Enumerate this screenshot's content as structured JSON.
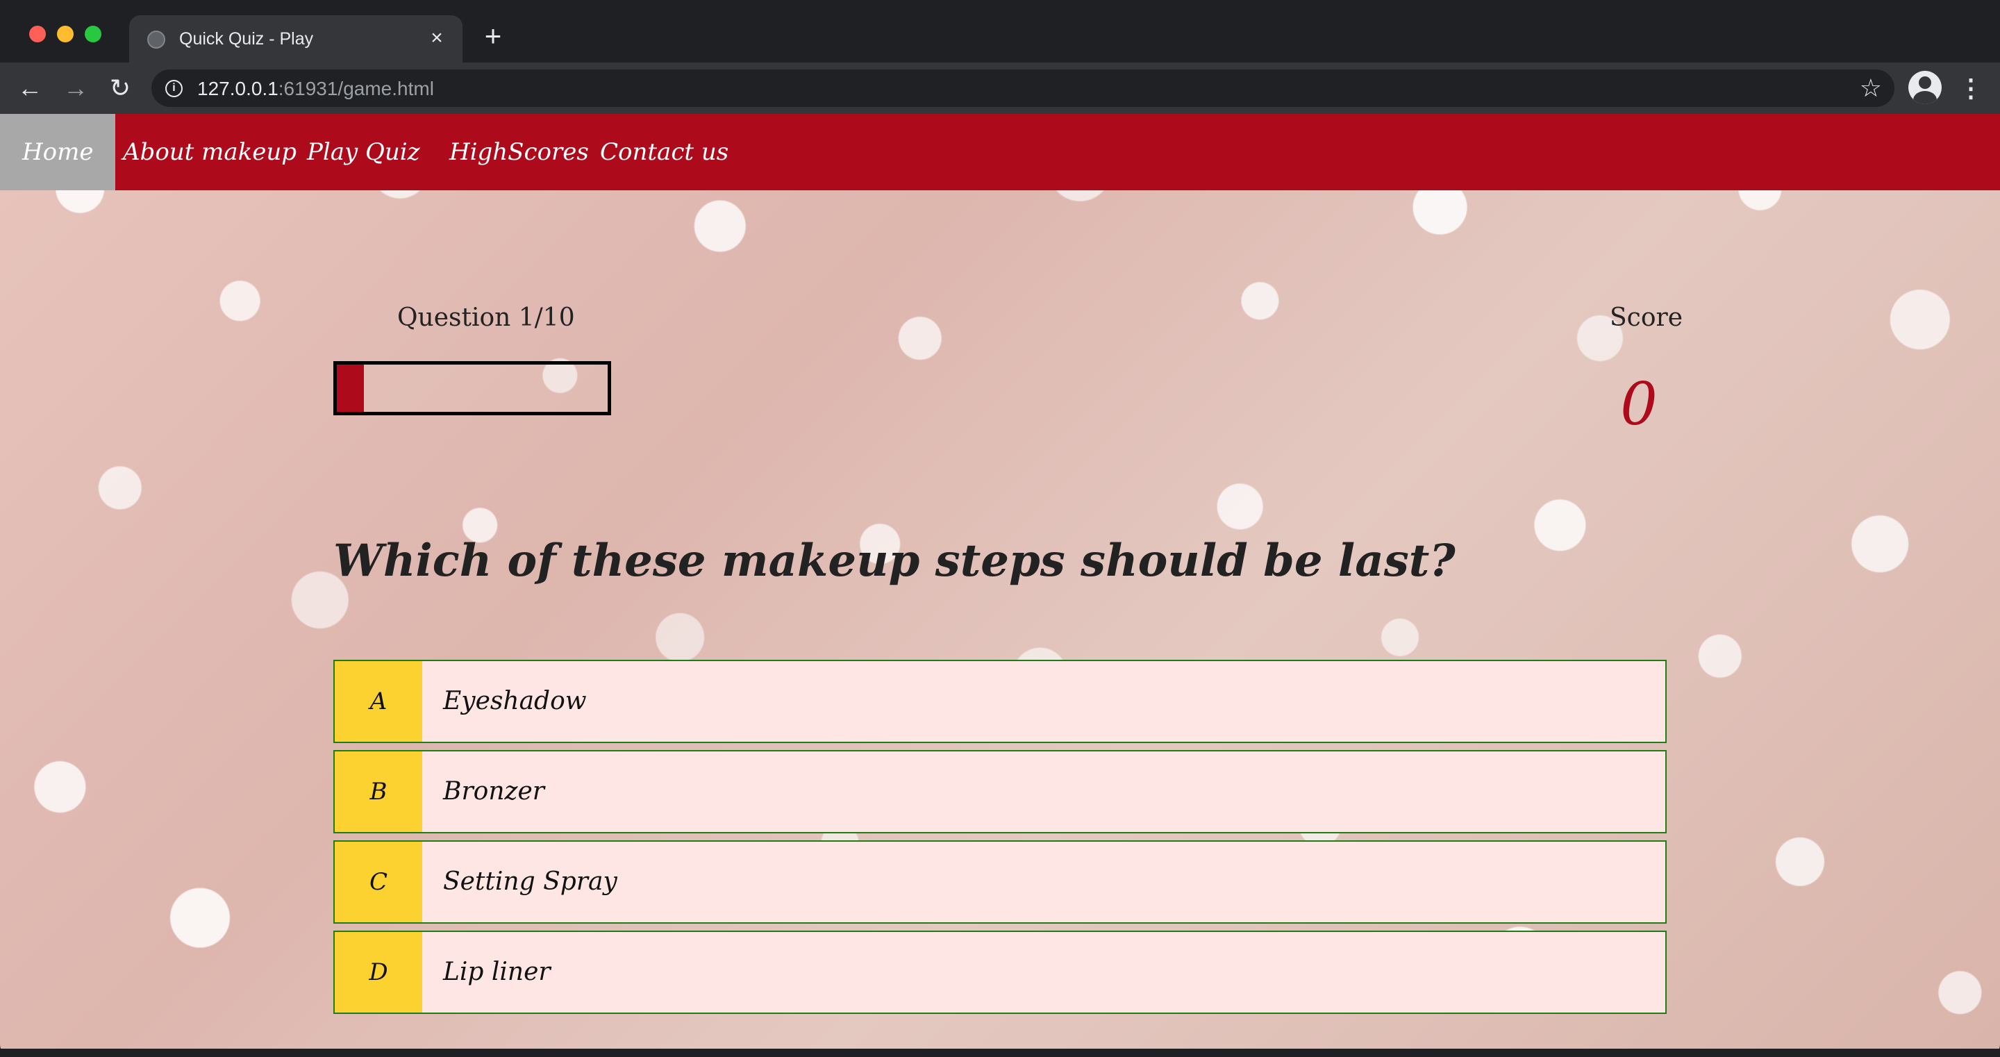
{
  "browser": {
    "tab_title": "Quick Quiz - Play",
    "tab_close": "×",
    "new_tab": "+",
    "url_host": "127.0.0.1",
    "url_rest": ":61931/game.html",
    "icons": {
      "back": "arrow-left-icon",
      "forward": "arrow-right-icon",
      "reload": "reload-icon",
      "info": "info-icon",
      "star": "star-icon",
      "profile": "profile-icon",
      "menu": "kebab-menu-icon"
    }
  },
  "navbar": {
    "items": [
      {
        "label": "Home",
        "active": true
      },
      {
        "label": "About makeup",
        "active": false
      },
      {
        "label": "Play Quiz",
        "active": false
      },
      {
        "label": "HighScores",
        "active": false
      },
      {
        "label": "Contact us",
        "active": false
      }
    ]
  },
  "hud": {
    "question_counter": "Question 1/10",
    "progress_fraction": 0.1,
    "score_label": "Score",
    "score_value": "0"
  },
  "question": {
    "text": "Which of these makeup steps should be last?"
  },
  "choices": [
    {
      "prefix": "A",
      "text": "Eyeshadow"
    },
    {
      "prefix": "B",
      "text": "Bronzer"
    },
    {
      "prefix": "C",
      "text": "Setting Spray"
    },
    {
      "prefix": "D",
      "text": "Lip liner"
    }
  ],
  "colors": {
    "brand_red": "#ad0b1c",
    "nav_active": "#a8a8a8",
    "choice_prefix": "#fcd230",
    "choice_background": "#fde6e3",
    "choice_border": "#1e7d16"
  }
}
